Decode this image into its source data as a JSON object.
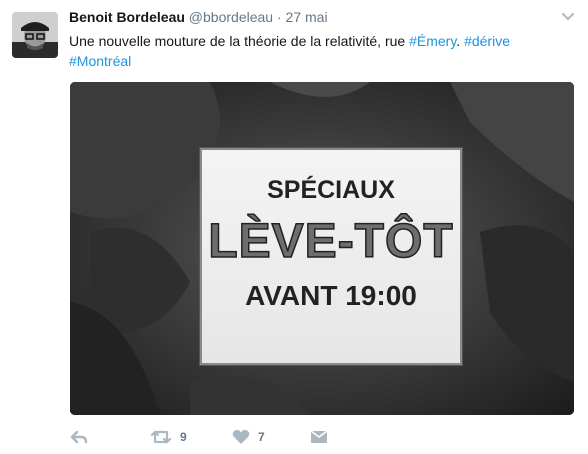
{
  "tweet": {
    "author_name": "Benoit Bordeleau",
    "handle": "@bbordeleau",
    "separator": "·",
    "time": "27 mai",
    "text_before": "Une nouvelle mouture de la théorie de la relativité, rue ",
    "tags": [
      "#Émery",
      "#dérive",
      "#Montréal"
    ],
    "text_after_first_tag": ". "
  },
  "media": {
    "sign_line1": "SPÉCIAUX",
    "sign_line2": "LÈVE-TÔT",
    "sign_line3": "AVANT 19:00"
  },
  "actions": {
    "retweets": "9",
    "likes": "7"
  },
  "colors": {
    "link": "#1b95e0",
    "muted": "#657786",
    "text": "#14171a"
  },
  "icons": [
    "reply-icon",
    "retweet-icon",
    "heart-icon",
    "direct-message-icon",
    "chevron-down-icon"
  ]
}
